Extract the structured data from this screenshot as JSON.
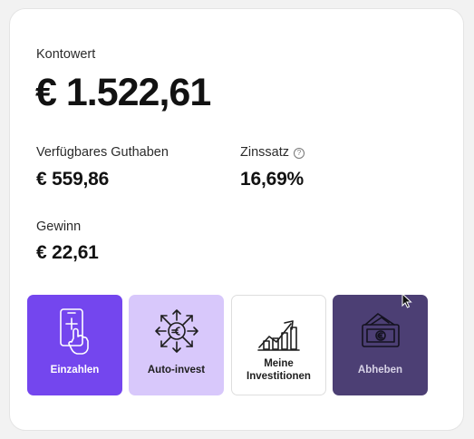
{
  "account": {
    "value_label": "Kontowert",
    "value": "€ 1.522,61",
    "available_label": "Verfügbares Guthaben",
    "available": "€ 559,86",
    "rate_label": "Zinssatz",
    "rate_info_icon": "question-circle-icon",
    "rate": "16,69%",
    "profit_label": "Gewinn",
    "profit": "€ 22,61"
  },
  "actions": [
    {
      "label": "Einzahlen",
      "icon": "phone-tap-plus-icon",
      "bg": "#7446ee"
    },
    {
      "label": "Auto-invest",
      "icon": "euro-coin-arrows-icon",
      "bg": "#d8c8fb"
    },
    {
      "label": "Meine Investitionen",
      "icon": "growth-chart-icon",
      "bg": "#ffffff"
    },
    {
      "label": "Abheben",
      "icon": "cash-wallet-icon",
      "bg": "#4c3f74"
    }
  ],
  "colors": {
    "accent": "#7446ee",
    "accent_light": "#d8c8fb",
    "accent_dark": "#4c3f74"
  }
}
